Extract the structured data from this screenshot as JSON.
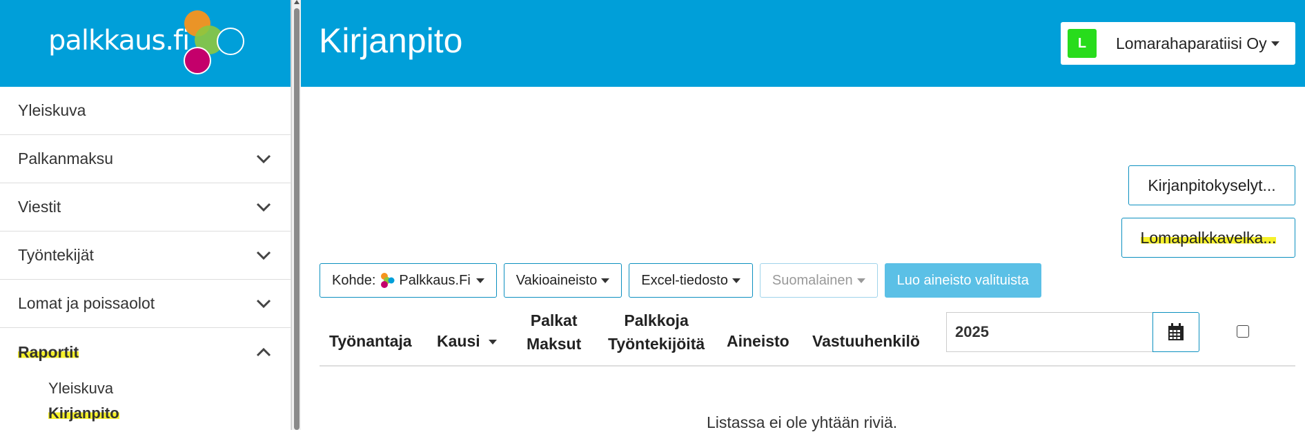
{
  "app": {
    "logo_text": "palkkaus.fi",
    "page_title": "Kirjanpito"
  },
  "company": {
    "badge": "L",
    "name": "Lomarahaparatiisi Oy",
    "badge_color": "#28dc1c"
  },
  "sidebar": {
    "items": [
      {
        "label": "Yleiskuva"
      },
      {
        "label": "Palkanmaksu"
      },
      {
        "label": "Viestit"
      },
      {
        "label": "Työntekijät"
      },
      {
        "label": "Lomat ja poissaolot"
      },
      {
        "label": "Raportit"
      }
    ],
    "sub_items": [
      {
        "label": "Yleiskuva"
      },
      {
        "label": "Kirjanpito"
      }
    ]
  },
  "actions": {
    "queries_label": "Kirjanpitokyselyt...",
    "holiday_debt_label": "Lomapalkkavelka..."
  },
  "toolbar": {
    "target_label": "Kohde:",
    "target_value": "Palkkaus.Fi",
    "standard_label": "Vakioaineisto",
    "excel_label": "Excel-tiedosto",
    "language_label": "Suomalainen",
    "create_label": "Luo aineisto valituista"
  },
  "table": {
    "headers": {
      "employer": "Työnantaja",
      "period": "Kausi",
      "salaries_line1": "Palkat",
      "salaries_line2": "Maksut",
      "paid_line1": "Palkkoja",
      "paid_line2": "Työntekijöitä",
      "material": "Aineisto",
      "responsible": "Vastuuhenkilö"
    },
    "year_value": "2025",
    "empty_message": "Listassa ei ole yhtään riviä."
  },
  "colors": {
    "brand_blue": "#009fd9",
    "highlight": "#f6f12b",
    "primary_button": "#5bc0e6"
  }
}
